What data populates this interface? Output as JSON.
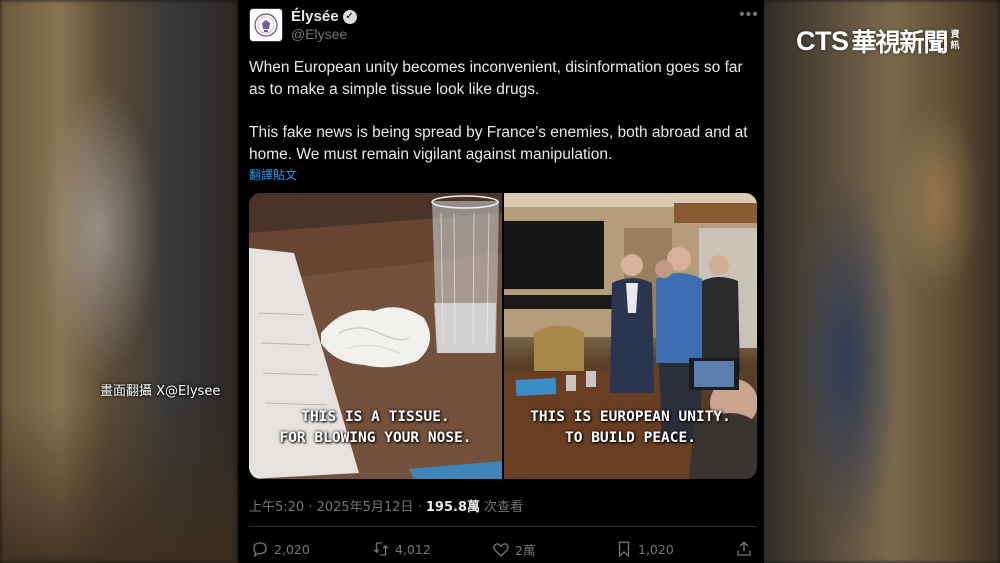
{
  "overlay": {
    "channel_logo_latin": "CTS",
    "channel_logo_cjk": "華視新聞",
    "channel_logo_sub": "資訊",
    "credit": "畫面翻攝 X@Elysee"
  },
  "tweet": {
    "author": "Élysée",
    "handle": "@Elysee",
    "paragraph_1": "When European unity becomes inconvenient, disinformation goes so far as to make a simple tissue look like drugs.",
    "paragraph_2": "This fake news is being spread by France’s enemies, both abroad and at home. We must remain vigilant against manipulation.",
    "translate_link": "翻譯貼文",
    "images": [
      {
        "caption_line_1": "THIS IS A TISSUE.",
        "caption_line_2": "FOR BLOWING YOUR NOSE."
      },
      {
        "caption_line_1": "THIS IS EUROPEAN UNITY.",
        "caption_line_2": "TO BUILD PEACE."
      }
    ],
    "timestamp": "上午5:20 · 2025年5月12日 · ",
    "views_count": "195.8萬",
    "views_label": " 次查看",
    "actions": {
      "replies": "2,020",
      "reposts": "4,012",
      "likes": "2萬",
      "bookmarks": "1,020"
    }
  },
  "colors": {
    "background": "#000000",
    "text": "#e7e9ea",
    "secondary": "#71767b",
    "link": "#1d9bf0"
  }
}
